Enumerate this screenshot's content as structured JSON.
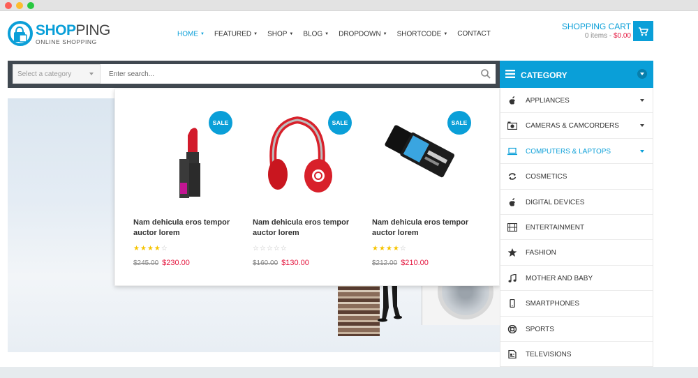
{
  "colors": {
    "accent": "#0a9fd8",
    "price": "#e4173f",
    "dark_bar": "#404850"
  },
  "logo": {
    "part1": "SHOP",
    "part2": "PING",
    "tagline": "ONLINE SHOPPING"
  },
  "nav": [
    {
      "label": "HOME",
      "has_caret": true,
      "active": true
    },
    {
      "label": "FEATURED",
      "has_caret": true
    },
    {
      "label": "SHOP",
      "has_caret": true
    },
    {
      "label": "BLOG",
      "has_caret": true
    },
    {
      "label": "DROPDOWN",
      "has_caret": true
    },
    {
      "label": "SHORTCODE",
      "has_caret": true
    },
    {
      "label": "CONTACT",
      "has_caret": false
    }
  ],
  "cart": {
    "title": "SHOPPING CART",
    "items": "0 items - ",
    "amount": "$0.00",
    "icon": "cart-icon"
  },
  "search": {
    "category_placeholder": "Select a category",
    "placeholder": "Enter search...",
    "icon": "search-icon"
  },
  "products": [
    {
      "badge": "SALE",
      "name": "Nam dehicula eros tempor auctor lorem",
      "rating": 4,
      "old_price": "$245.00",
      "price": "$230.00",
      "image": "lipstick"
    },
    {
      "badge": "SALE",
      "name": "Nam dehicula eros tempor auctor lorem",
      "rating": 0,
      "old_price": "$160.00",
      "price": "$130.00",
      "image": "headphones"
    },
    {
      "badge": "SALE",
      "name": "Nam dehicula eros tempor auctor lorem",
      "rating": 4,
      "old_price": "$212.00",
      "price": "$210.00",
      "image": "usb-drive"
    }
  ],
  "category": {
    "title": "CATEGORY",
    "items": [
      {
        "label": "APPLIANCES",
        "icon": "apple-icon",
        "has_caret": true
      },
      {
        "label": "CAMERAS & CAMCORDERS",
        "icon": "camera-icon",
        "has_caret": true
      },
      {
        "label": "COMPUTERS & LAPTOPS",
        "icon": "laptop-icon",
        "has_caret": true,
        "active": true
      },
      {
        "label": "COSMETICS",
        "icon": "refresh-icon",
        "has_caret": false
      },
      {
        "label": "DIGITAL DEVICES",
        "icon": "apple-icon",
        "has_caret": false
      },
      {
        "label": "ENTERTAINMENT",
        "icon": "film-icon",
        "has_caret": false
      },
      {
        "label": "FASHION",
        "icon": "star-icon",
        "has_caret": false
      },
      {
        "label": "MOTHER AND BABY",
        "icon": "music-icon",
        "has_caret": false
      },
      {
        "label": "SMARTPHONES",
        "icon": "mobile-icon",
        "has_caret": false
      },
      {
        "label": "SPORTS",
        "icon": "lifebuoy-icon",
        "has_caret": false
      },
      {
        "label": "TELEVISIONS",
        "icon": "document-icon",
        "has_caret": false
      }
    ]
  }
}
